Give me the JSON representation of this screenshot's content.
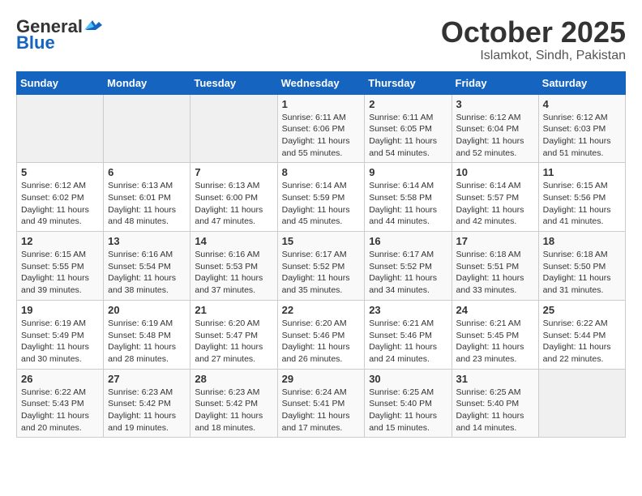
{
  "header": {
    "logo_general": "General",
    "logo_blue": "Blue",
    "month_title": "October 2025",
    "subtitle": "Islamkot, Sindh, Pakistan"
  },
  "weekdays": [
    "Sunday",
    "Monday",
    "Tuesday",
    "Wednesday",
    "Thursday",
    "Friday",
    "Saturday"
  ],
  "weeks": [
    [
      {
        "day": "",
        "info": ""
      },
      {
        "day": "",
        "info": ""
      },
      {
        "day": "",
        "info": ""
      },
      {
        "day": "1",
        "info": "Sunrise: 6:11 AM\nSunset: 6:06 PM\nDaylight: 11 hours\nand 55 minutes."
      },
      {
        "day": "2",
        "info": "Sunrise: 6:11 AM\nSunset: 6:05 PM\nDaylight: 11 hours\nand 54 minutes."
      },
      {
        "day": "3",
        "info": "Sunrise: 6:12 AM\nSunset: 6:04 PM\nDaylight: 11 hours\nand 52 minutes."
      },
      {
        "day": "4",
        "info": "Sunrise: 6:12 AM\nSunset: 6:03 PM\nDaylight: 11 hours\nand 51 minutes."
      }
    ],
    [
      {
        "day": "5",
        "info": "Sunrise: 6:12 AM\nSunset: 6:02 PM\nDaylight: 11 hours\nand 49 minutes."
      },
      {
        "day": "6",
        "info": "Sunrise: 6:13 AM\nSunset: 6:01 PM\nDaylight: 11 hours\nand 48 minutes."
      },
      {
        "day": "7",
        "info": "Sunrise: 6:13 AM\nSunset: 6:00 PM\nDaylight: 11 hours\nand 47 minutes."
      },
      {
        "day": "8",
        "info": "Sunrise: 6:14 AM\nSunset: 5:59 PM\nDaylight: 11 hours\nand 45 minutes."
      },
      {
        "day": "9",
        "info": "Sunrise: 6:14 AM\nSunset: 5:58 PM\nDaylight: 11 hours\nand 44 minutes."
      },
      {
        "day": "10",
        "info": "Sunrise: 6:14 AM\nSunset: 5:57 PM\nDaylight: 11 hours\nand 42 minutes."
      },
      {
        "day": "11",
        "info": "Sunrise: 6:15 AM\nSunset: 5:56 PM\nDaylight: 11 hours\nand 41 minutes."
      }
    ],
    [
      {
        "day": "12",
        "info": "Sunrise: 6:15 AM\nSunset: 5:55 PM\nDaylight: 11 hours\nand 39 minutes."
      },
      {
        "day": "13",
        "info": "Sunrise: 6:16 AM\nSunset: 5:54 PM\nDaylight: 11 hours\nand 38 minutes."
      },
      {
        "day": "14",
        "info": "Sunrise: 6:16 AM\nSunset: 5:53 PM\nDaylight: 11 hours\nand 37 minutes."
      },
      {
        "day": "15",
        "info": "Sunrise: 6:17 AM\nSunset: 5:52 PM\nDaylight: 11 hours\nand 35 minutes."
      },
      {
        "day": "16",
        "info": "Sunrise: 6:17 AM\nSunset: 5:52 PM\nDaylight: 11 hours\nand 34 minutes."
      },
      {
        "day": "17",
        "info": "Sunrise: 6:18 AM\nSunset: 5:51 PM\nDaylight: 11 hours\nand 33 minutes."
      },
      {
        "day": "18",
        "info": "Sunrise: 6:18 AM\nSunset: 5:50 PM\nDaylight: 11 hours\nand 31 minutes."
      }
    ],
    [
      {
        "day": "19",
        "info": "Sunrise: 6:19 AM\nSunset: 5:49 PM\nDaylight: 11 hours\nand 30 minutes."
      },
      {
        "day": "20",
        "info": "Sunrise: 6:19 AM\nSunset: 5:48 PM\nDaylight: 11 hours\nand 28 minutes."
      },
      {
        "day": "21",
        "info": "Sunrise: 6:20 AM\nSunset: 5:47 PM\nDaylight: 11 hours\nand 27 minutes."
      },
      {
        "day": "22",
        "info": "Sunrise: 6:20 AM\nSunset: 5:46 PM\nDaylight: 11 hours\nand 26 minutes."
      },
      {
        "day": "23",
        "info": "Sunrise: 6:21 AM\nSunset: 5:46 PM\nDaylight: 11 hours\nand 24 minutes."
      },
      {
        "day": "24",
        "info": "Sunrise: 6:21 AM\nSunset: 5:45 PM\nDaylight: 11 hours\nand 23 minutes."
      },
      {
        "day": "25",
        "info": "Sunrise: 6:22 AM\nSunset: 5:44 PM\nDaylight: 11 hours\nand 22 minutes."
      }
    ],
    [
      {
        "day": "26",
        "info": "Sunrise: 6:22 AM\nSunset: 5:43 PM\nDaylight: 11 hours\nand 20 minutes."
      },
      {
        "day": "27",
        "info": "Sunrise: 6:23 AM\nSunset: 5:42 PM\nDaylight: 11 hours\nand 19 minutes."
      },
      {
        "day": "28",
        "info": "Sunrise: 6:23 AM\nSunset: 5:42 PM\nDaylight: 11 hours\nand 18 minutes."
      },
      {
        "day": "29",
        "info": "Sunrise: 6:24 AM\nSunset: 5:41 PM\nDaylight: 11 hours\nand 17 minutes."
      },
      {
        "day": "30",
        "info": "Sunrise: 6:25 AM\nSunset: 5:40 PM\nDaylight: 11 hours\nand 15 minutes."
      },
      {
        "day": "31",
        "info": "Sunrise: 6:25 AM\nSunset: 5:40 PM\nDaylight: 11 hours\nand 14 minutes."
      },
      {
        "day": "",
        "info": ""
      }
    ]
  ]
}
